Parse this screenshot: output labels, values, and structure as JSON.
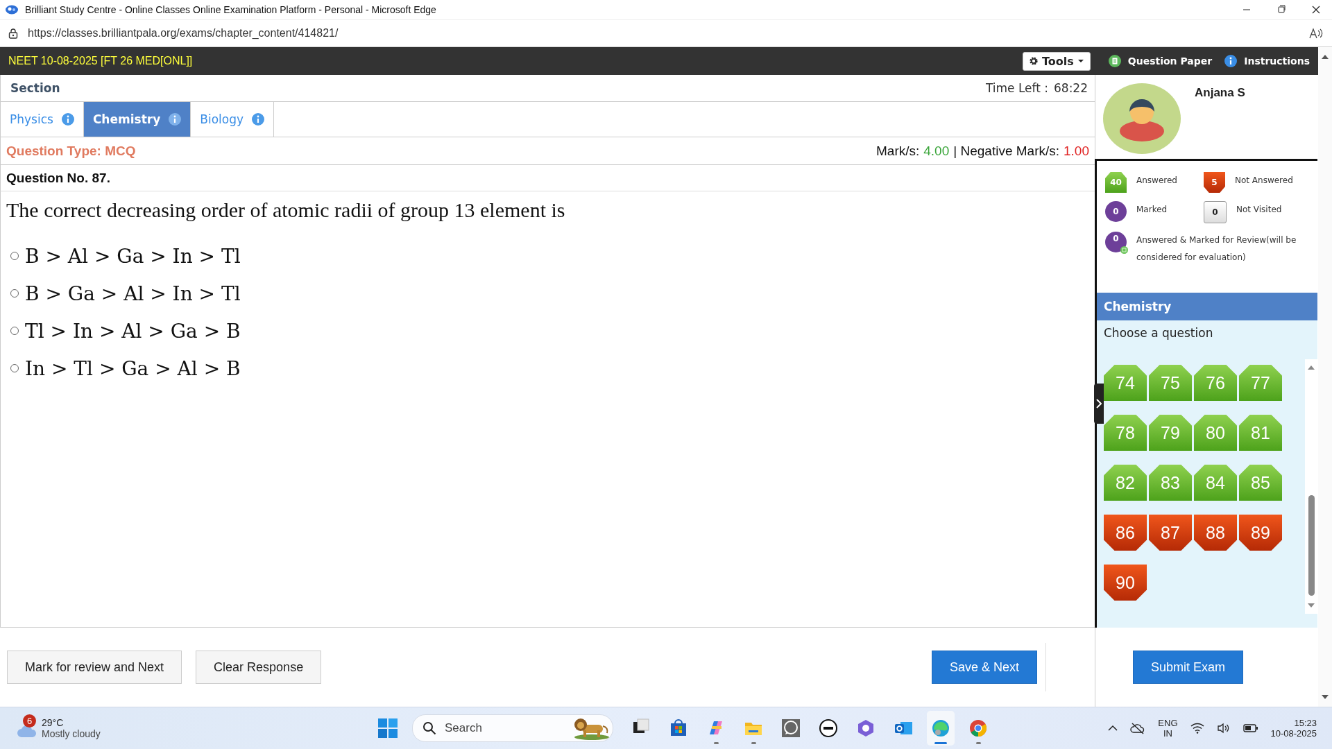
{
  "browser": {
    "title": "Brilliant Study Centre - Online Classes Online Examination Platform - Personal - Microsoft Edge",
    "url": "https://classes.brilliantpala.org/exams/chapter_content/414821/"
  },
  "header": {
    "exam_title": "NEET 10-08-2025 [FT 26 MED[ONL]]",
    "tools": "Tools",
    "links": [
      {
        "label": "Question Paper",
        "kind": "paper"
      },
      {
        "label": "Instructions",
        "kind": "info"
      }
    ]
  },
  "section": {
    "label": "Section",
    "time_left_label": "Time Left :",
    "time_left": "68:22"
  },
  "tabs": [
    {
      "label": "Physics",
      "selected": false
    },
    {
      "label": "Chemistry",
      "selected": true
    },
    {
      "label": "Biology",
      "selected": false
    }
  ],
  "question": {
    "type": "Question Type: MCQ",
    "marks_label": "Mark/s:",
    "marks": "4.00",
    "negative_label": "| Negative Mark/s:",
    "negative_marks": "1.00",
    "number": "Question No. 87.",
    "text": "The correct decreasing order of atomic radii of group 13 element is",
    "options": [
      {
        "text": "B > Al > Ga > In > Tl",
        "selected": false
      },
      {
        "text": "B > Ga > Al > In > Tl",
        "selected": false
      },
      {
        "text": "Tl > In > Al > Ga > B",
        "selected": false
      },
      {
        "text": "In > Tl > Ga > Al > B",
        "selected": false
      }
    ]
  },
  "profile": {
    "name": "Anjana S"
  },
  "legend": [
    {
      "count": "40",
      "label": "Answered",
      "kind": "answered"
    },
    {
      "count": "5",
      "label": "Not Answered",
      "kind": "not_answered"
    },
    {
      "count": "0",
      "label": "Marked",
      "kind": "marked"
    },
    {
      "count": "0",
      "label": "Not Visited",
      "kind": "not_visited"
    },
    {
      "count": "0",
      "label": "Answered & Marked for Review(will be considered for evaluation)",
      "kind": "answered_marked"
    }
  ],
  "palette": {
    "section": "Chemistry",
    "prompt": "Choose a question",
    "questions": [
      {
        "number": "74",
        "kind": "answered"
      },
      {
        "number": "75",
        "kind": "answered"
      },
      {
        "number": "76",
        "kind": "answered"
      },
      {
        "number": "77",
        "kind": "answered"
      },
      {
        "number": "78",
        "kind": "answered"
      },
      {
        "number": "79",
        "kind": "answered"
      },
      {
        "number": "80",
        "kind": "answered"
      },
      {
        "number": "81",
        "kind": "answered"
      },
      {
        "number": "82",
        "kind": "answered"
      },
      {
        "number": "83",
        "kind": "answered"
      },
      {
        "number": "84",
        "kind": "answered"
      },
      {
        "number": "85",
        "kind": "answered"
      },
      {
        "number": "86",
        "kind": "not_answered"
      },
      {
        "number": "87",
        "kind": "not_answered"
      },
      {
        "number": "88",
        "kind": "not_answered"
      },
      {
        "number": "89",
        "kind": "not_answered"
      },
      {
        "number": "90",
        "kind": "not_answered"
      }
    ]
  },
  "buttons": {
    "mark_review": "Mark for review and Next",
    "clear": "Clear Response",
    "save_next": "Save & Next",
    "submit": "Submit Exam"
  },
  "taskbar": {
    "weather": {
      "badge": "6",
      "temperature": "29°C",
      "condition": "Mostly cloudy"
    },
    "search": {
      "placeholder": "Search"
    },
    "apps": [
      {
        "kind": "taskview",
        "running": false,
        "active": false
      },
      {
        "kind": "store",
        "running": false,
        "active": false
      },
      {
        "kind": "copilot",
        "running": true,
        "active": false
      },
      {
        "kind": "files",
        "running": true,
        "active": false
      },
      {
        "kind": "whatsapp",
        "running": false,
        "active": false
      },
      {
        "kind": "dell",
        "running": false,
        "active": false
      },
      {
        "kind": "m365",
        "running": false,
        "active": false
      },
      {
        "kind": "outlook",
        "running": false,
        "active": false
      },
      {
        "kind": "edge",
        "running": true,
        "active": true
      },
      {
        "kind": "chrome",
        "running": true,
        "active": false
      }
    ],
    "language": "ENG",
    "region": "IN",
    "time": "15:23",
    "date": "10-08-2025"
  }
}
